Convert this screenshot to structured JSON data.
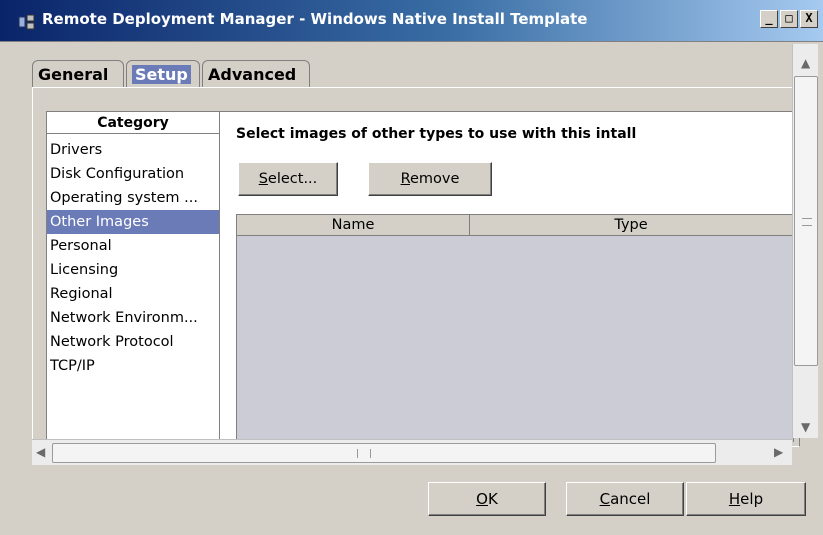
{
  "window": {
    "title": "Remote Deployment Manager - Windows Native Install Template",
    "controls": [
      "_",
      "□",
      "X"
    ]
  },
  "tabs": [
    {
      "label": "General",
      "active": false
    },
    {
      "label": "Setup",
      "active": true
    },
    {
      "label": "Advanced",
      "active": false
    }
  ],
  "category": {
    "header": "Category",
    "items": [
      {
        "label": "Drivers"
      },
      {
        "label": "Disk Configuration"
      },
      {
        "label": "Operating system ..."
      },
      {
        "label": "Other Images",
        "selected": true
      },
      {
        "label": "Personal"
      },
      {
        "label": "Licensing"
      },
      {
        "label": "Regional"
      },
      {
        "label": "Network Environm..."
      },
      {
        "label": "Network Protocol"
      },
      {
        "label": "TCP/IP"
      }
    ]
  },
  "content": {
    "instruction": "Select images of other types to use with this intall",
    "select_button": {
      "mnemonic": "S",
      "rest": "elect..."
    },
    "remove_button": {
      "mnemonic": "R",
      "rest": "emove"
    },
    "table": {
      "columns": [
        "Name",
        "Type"
      ],
      "rows": []
    }
  },
  "footer": {
    "ok": {
      "mnemonic": "O",
      "rest": "K"
    },
    "cancel": {
      "mnemonic": "C",
      "rest": "ancel"
    },
    "help": {
      "mnemonic": "H",
      "rest": "elp"
    }
  },
  "icons": {
    "app": "app-icon",
    "minimize": "minimize-icon",
    "maximize": "maximize-icon",
    "close": "close-icon"
  },
  "colors": {
    "selection": "#6b7bb7",
    "face": "#d4d0c8",
    "title_start": "#0a246a"
  }
}
